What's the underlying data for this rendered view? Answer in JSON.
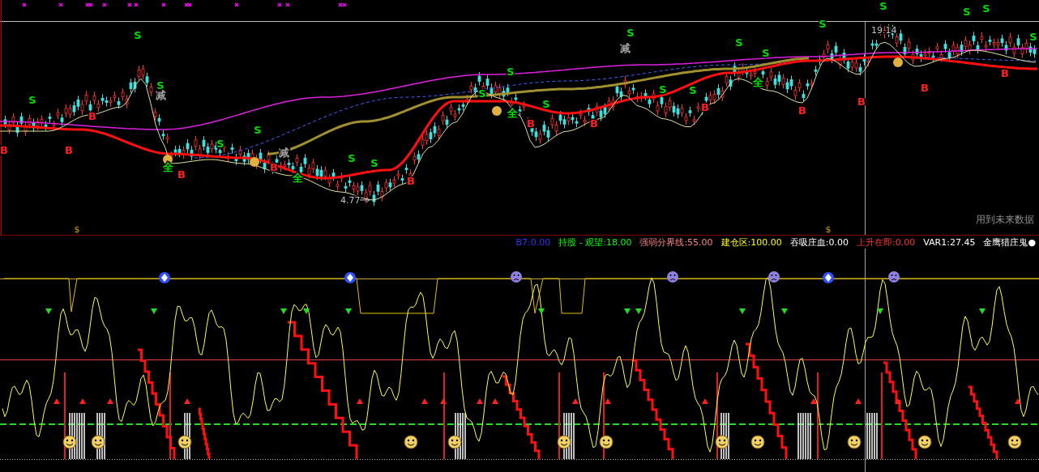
{
  "top_panel": {
    "signals": [
      {
        "text": "S",
        "kind": "sell"
      },
      {
        "text": "S",
        "kind": "sell"
      },
      {
        "text": "S",
        "kind": "sell"
      },
      {
        "text": "S",
        "kind": "sell"
      },
      {
        "text": "S",
        "kind": "sell"
      },
      {
        "text": "S",
        "kind": "sell"
      },
      {
        "text": "S",
        "kind": "sell"
      },
      {
        "text": "S",
        "kind": "sell"
      },
      {
        "text": "S",
        "kind": "sell"
      },
      {
        "text": "S",
        "kind": "sell"
      },
      {
        "text": "S",
        "kind": "sell"
      },
      {
        "text": "S",
        "kind": "sell"
      },
      {
        "text": "S",
        "kind": "sell"
      },
      {
        "text": "S",
        "kind": "sell"
      },
      {
        "text": "S",
        "kind": "sell"
      },
      {
        "text": "S",
        "kind": "sell"
      },
      {
        "text": "S",
        "kind": "sell"
      },
      {
        "text": "S",
        "kind": "sell"
      },
      {
        "text": "S",
        "kind": "sell"
      },
      {
        "text": "S",
        "kind": "sell"
      },
      {
        "text": "B",
        "kind": "buy"
      },
      {
        "text": "B",
        "kind": "buy"
      },
      {
        "text": "B",
        "kind": "buy"
      },
      {
        "text": "B",
        "kind": "buy"
      },
      {
        "text": "B",
        "kind": "buy"
      },
      {
        "text": "B",
        "kind": "buy"
      },
      {
        "text": "B",
        "kind": "buy"
      },
      {
        "text": "B",
        "kind": "buy"
      },
      {
        "text": "B",
        "kind": "buy"
      },
      {
        "text": "B",
        "kind": "buy"
      },
      {
        "text": "B",
        "kind": "buy"
      },
      {
        "text": "B",
        "kind": "buy"
      },
      {
        "text": "B",
        "kind": "buy"
      },
      {
        "text": "全",
        "kind": "full"
      },
      {
        "text": "全",
        "kind": "full"
      },
      {
        "text": "全",
        "kind": "full"
      },
      {
        "text": "全",
        "kind": "full"
      },
      {
        "text": "减",
        "kind": "reduce"
      },
      {
        "text": "减",
        "kind": "reduce"
      },
      {
        "text": "减",
        "kind": "reduce"
      }
    ],
    "price_labels": [
      {
        "text": "19.14",
        "kind": "high"
      },
      {
        "text": "4.77",
        "kind": "low"
      }
    ],
    "notice": "用到未来数据",
    "axis_marks": [
      "$",
      "$"
    ]
  },
  "indicator": {
    "legend": [
      {
        "text": "B7:0.00",
        "color": "#3030ff"
      },
      {
        "text": "持股 - 观望:18.00",
        "color": "#00ff00"
      },
      {
        "text": "强弱分界线:55.00",
        "color": "#ff8080"
      },
      {
        "text": "建仓区:100.00",
        "color": "#ffff00"
      },
      {
        "text": "吞吸庄血:0.00",
        "color": "#ffffff"
      },
      {
        "text": "上升在即:0.00",
        "color": "#ff3030"
      },
      {
        "text": "VAR1:27.45",
        "color": "#ffffff"
      },
      {
        "text": "金鹰猎庄鬼●",
        "color": "#ffffff"
      }
    ]
  }
}
